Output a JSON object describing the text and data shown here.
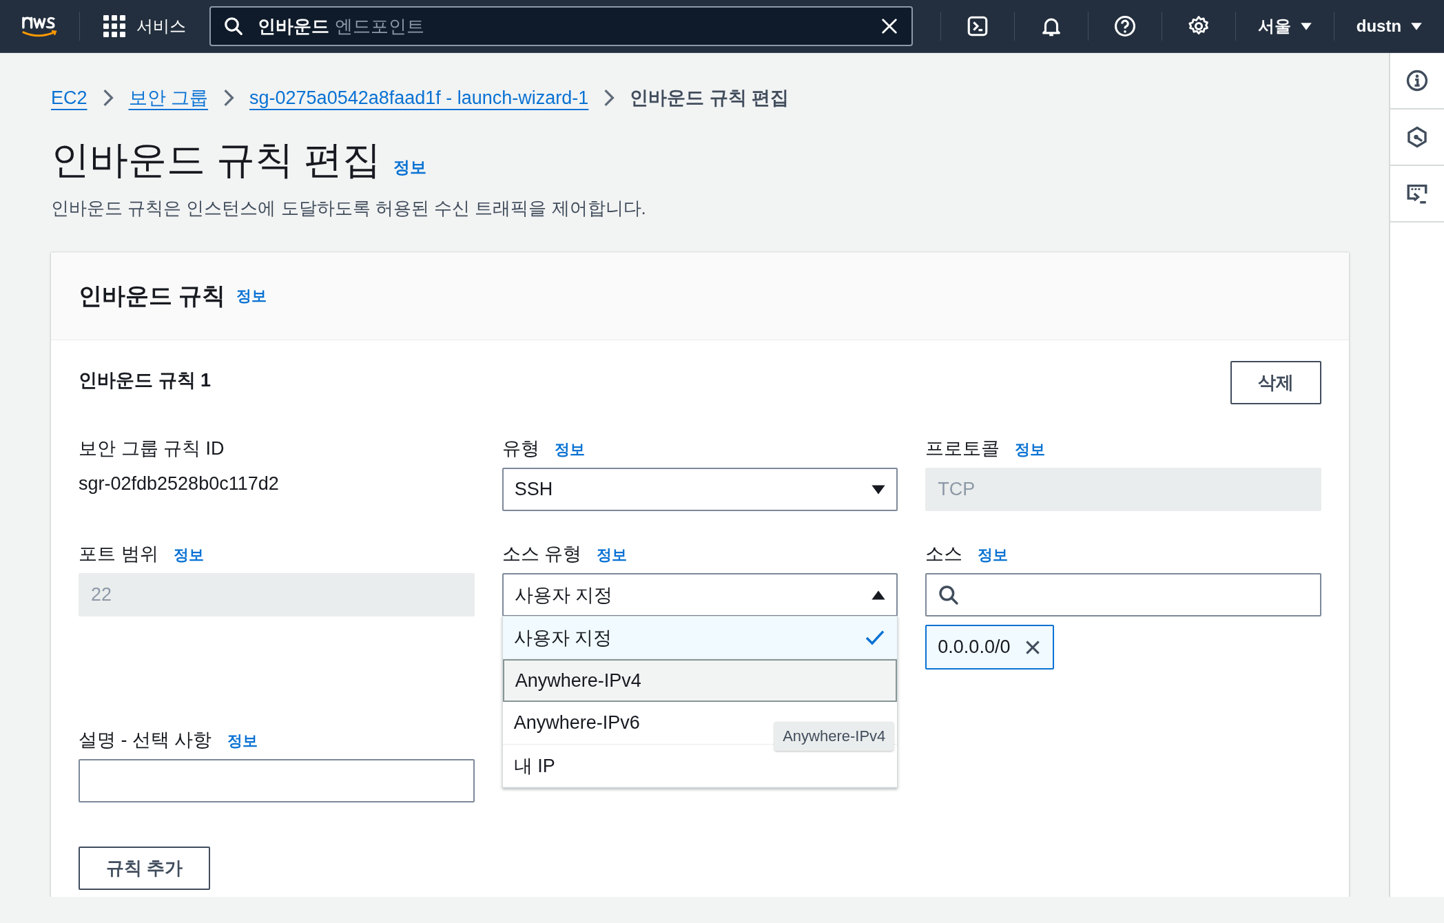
{
  "top_nav": {
    "services_label": "서비스",
    "search": {
      "value": "인바운드",
      "completion": "엔드포인트"
    },
    "region": "서울",
    "user": "dustn"
  },
  "breadcrumbs": [
    {
      "label": "EC2",
      "link": true
    },
    {
      "label": "보안 그룹",
      "link": true
    },
    {
      "label": "sg-0275a0542a8faad1f - launch-wizard-1",
      "link": true
    },
    {
      "label": "인바운드 규칙 편집",
      "link": false
    }
  ],
  "page": {
    "title": "인바운드 규칙 편집",
    "info": "정보",
    "description": "인바운드 규칙은 인스턴스에 도달하도록 허용된 수신 트래픽을 제어합니다."
  },
  "panel": {
    "title": "인바운드 규칙",
    "info": "정보",
    "rule": {
      "title": "인바운드 규칙 1",
      "delete_button": "삭제",
      "fields": [
        {
          "kind": "text",
          "label": "보안 그룹 규칙 ID",
          "value": "sgr-02fdb2528b0c117d2"
        },
        {
          "kind": "select",
          "label": "유형",
          "info": "정보",
          "value": "SSH",
          "expanded": false
        },
        {
          "kind": "readonly",
          "label": "프로토콜",
          "info": "정보",
          "value": "TCP"
        },
        {
          "kind": "readonly",
          "label": "포트 범위",
          "info": "정보",
          "value": "22"
        },
        {
          "kind": "select",
          "label": "소스 유형",
          "info": "정보",
          "value": "사용자 지정",
          "expanded": true,
          "options": [
            {
              "label": "사용자 지정",
              "selected": true,
              "highlighted": false
            },
            {
              "label": "Anywhere-IPv4",
              "selected": false,
              "highlighted": true
            },
            {
              "label": "Anywhere-IPv6",
              "selected": false,
              "highlighted": false
            },
            {
              "label": "내 IP",
              "selected": false,
              "highlighted": false
            }
          ]
        },
        {
          "kind": "search",
          "label": "소스",
          "info": "정보",
          "tags": [
            "0.0.0.0/0"
          ]
        },
        {
          "kind": "input",
          "label": "설명 - 선택 사항",
          "info": "정보"
        }
      ]
    },
    "tooltip": "Anywhere-IPv4",
    "add_rule_button": "규칙 추가"
  }
}
